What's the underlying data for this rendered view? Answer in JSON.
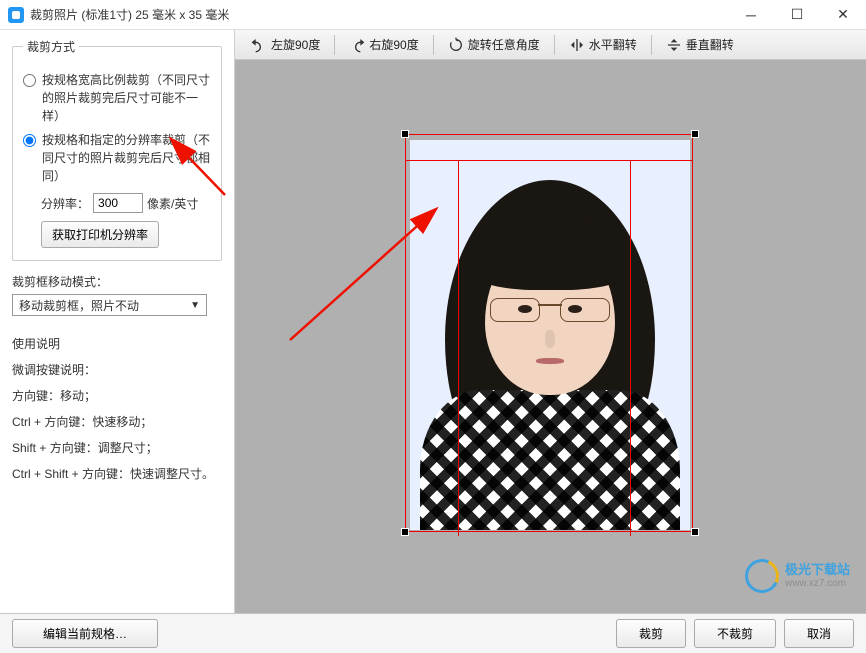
{
  "window": {
    "title": "裁剪照片 (标准1寸) 25 毫米 x 35 毫米"
  },
  "sidebar": {
    "crop_mode_legend": "裁剪方式",
    "radio1": "按规格宽高比例裁剪（不同尺寸的照片裁剪完后尺寸可能不一样）",
    "radio2": "按规格和指定的分辨率裁剪（不同尺寸的照片裁剪完后尺寸都相同）",
    "res_label": "分辨率：",
    "res_value": "300",
    "res_unit": "像素/英寸",
    "get_printer_res": "获取打印机分辨率",
    "move_mode_label": "裁剪框移动模式：",
    "move_mode_value": "移动裁剪框，照片不动",
    "help_title": "使用说明",
    "help_subtitle": "微调按键说明：",
    "help_1": "方向键：移动；",
    "help_2": "Ctrl + 方向键：快速移动；",
    "help_3": "Shift + 方向键：调整尺寸；",
    "help_4": "Ctrl + Shift + 方向键：快速调整尺寸。"
  },
  "toolbar": {
    "rotate_left": "左旋90度",
    "rotate_right": "右旋90度",
    "rotate_any": "旋转任意角度",
    "flip_h": "水平翻转",
    "flip_v": "垂直翻转"
  },
  "bottom": {
    "edit_spec": "编辑当前规格…",
    "crop": "裁剪",
    "no_crop": "不裁剪",
    "cancel": "取消"
  },
  "watermark": {
    "brand": "极光下载站",
    "url": "www.xz7.com"
  }
}
